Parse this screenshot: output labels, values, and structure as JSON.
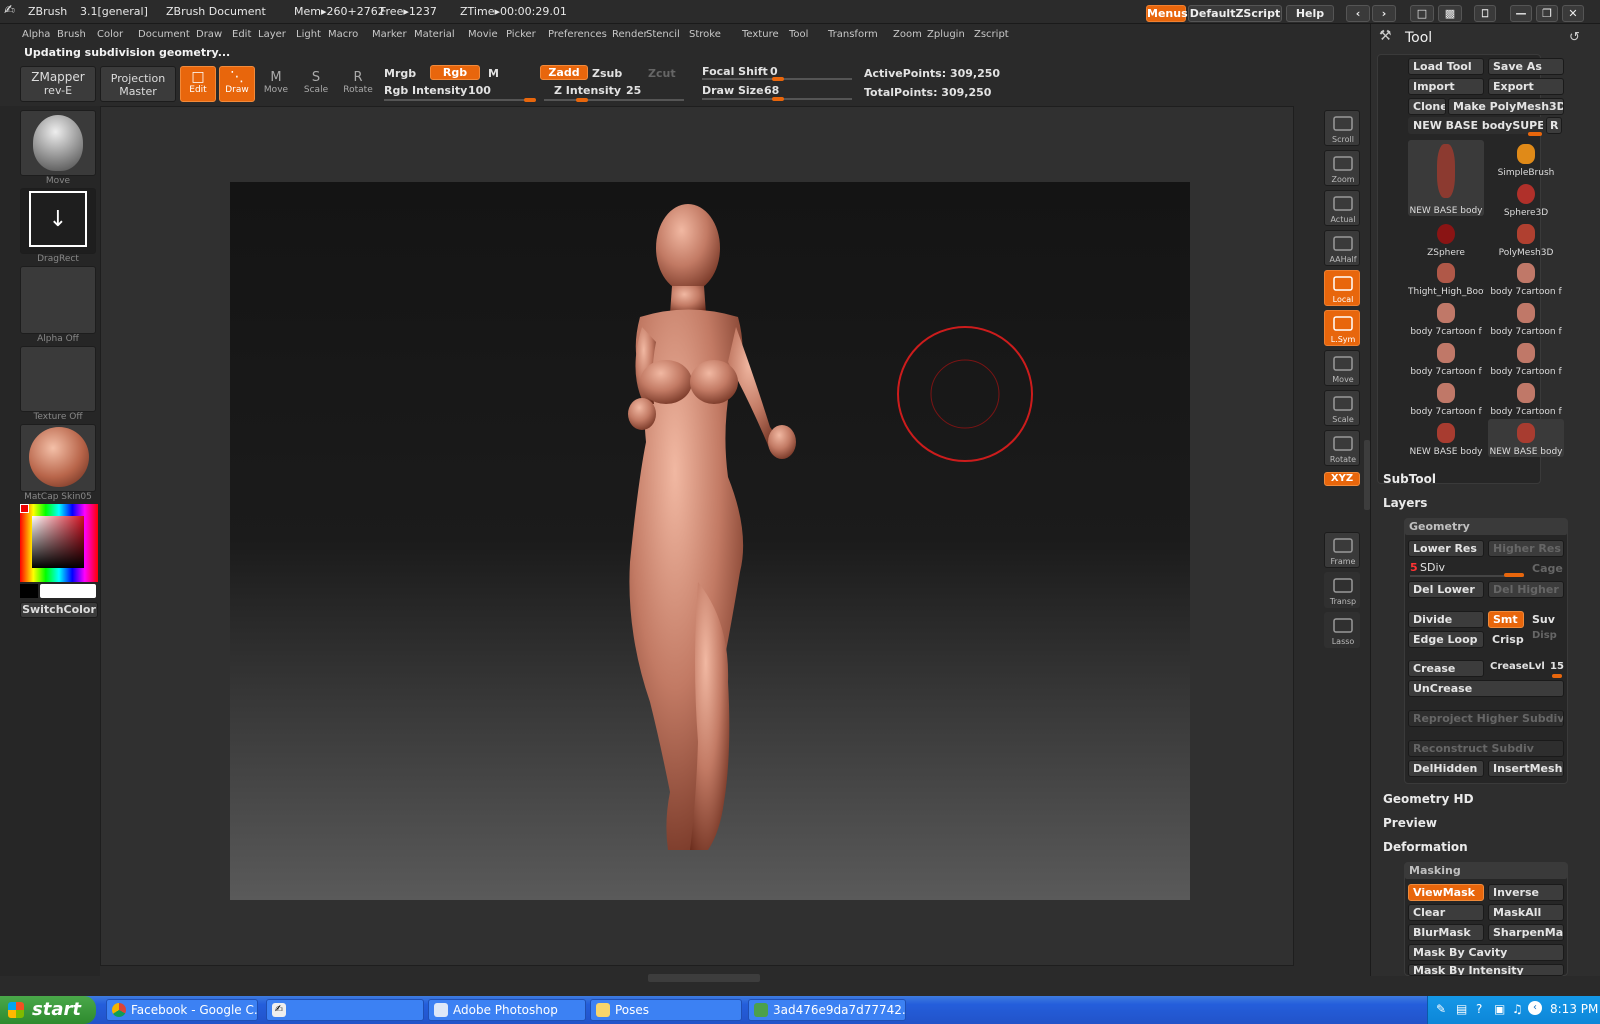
{
  "titlebar": {
    "app": "ZBrush",
    "version": "3.1[general]",
    "document": "ZBrush Document",
    "mem": "Mem▸260+2762",
    "free": "Free▸1237",
    "ztime": "ZTime▸00:00:29.01",
    "menus_btn": "Menus",
    "script_btn": "DefaultZScript",
    "help_btn": "Help"
  },
  "menubar": [
    "Alpha",
    "Brush",
    "Color",
    "Document",
    "Draw",
    "Edit",
    "Layer",
    "Light",
    "Macro",
    "Marker",
    "Material",
    "Movie",
    "Picker",
    "Preferences",
    "Render",
    "Stencil",
    "Stroke",
    "Texture",
    "Tool",
    "Transform",
    "Zoom",
    "Zplugin",
    "Zscript"
  ],
  "status": "Updating subdivision geometry...",
  "topbar": {
    "zmapper": "ZMapper",
    "zmapper_sub": "rev-E",
    "projection": "Projection",
    "projection_sub": "Master",
    "edit": "Edit",
    "draw": "Draw",
    "move": "Move",
    "scale": "Scale",
    "rotate": "Rotate",
    "mrgb": "Mrgb",
    "rgb": "Rgb",
    "m": "M",
    "zadd": "Zadd",
    "zsub": "Zsub",
    "zcut": "Zcut",
    "rgb_intensity_label": "Rgb Intensity",
    "rgb_intensity": "100",
    "z_intensity_label": "Z Intensity",
    "z_intensity": "25",
    "focal_shift_label": "Focal Shift",
    "focal_shift": "0",
    "draw_size_label": "Draw Size",
    "draw_size": "68",
    "active_points": "ActivePoints: 309,250",
    "total_points": "TotalPoints: 309,250"
  },
  "left": {
    "brush_caption": "Move",
    "stroke_caption": "DragRect",
    "alpha_caption": "Alpha  Off",
    "texture_caption": "Texture  Off",
    "material_caption": "MatCap  Skin05",
    "switchcolor": "SwitchColor"
  },
  "right_tools": [
    "Scroll",
    "Zoom",
    "Actual",
    "AAHalf",
    "Local",
    "L.Sym",
    "Move",
    "Scale",
    "Rotate",
    "XYZ",
    "Frame",
    "Transp",
    "Lasso"
  ],
  "tool_panel": {
    "title": "Tool",
    "load_tool": "Load Tool",
    "save_as": "Save As",
    "import": "Import",
    "export": "Export",
    "clone": "Clone",
    "make_polymesh": "Make PolyMesh3D",
    "current_tool": "NEW  BASE  bodySUPERGI",
    "r_btn": "R",
    "tools": [
      {
        "name": "NEW  BASE  body"
      },
      {
        "name": "SimpleBrush"
      },
      {
        "name": "Sphere3D"
      },
      {
        "name": "ZSphere"
      },
      {
        "name": "PolyMesh3D"
      },
      {
        "name": "Thight_High_Boot"
      },
      {
        "name": "body  7cartoon  f"
      },
      {
        "name": "body  7cartoon  f"
      },
      {
        "name": "body  7cartoon  f"
      },
      {
        "name": "body  7cartoon  f"
      },
      {
        "name": "body  7cartoon  f"
      },
      {
        "name": "body  7cartoon  f"
      },
      {
        "name": "body  7cartoon  f"
      },
      {
        "name": "NEW  BASE  body"
      },
      {
        "name": "NEW  BASE  body"
      }
    ],
    "subtool": "SubTool",
    "layers": "Layers",
    "geometry": "Geometry",
    "lower_res": "Lower Res",
    "higher_res": "Higher Res",
    "sdiv_value": "5",
    "sdiv_label": "SDiv",
    "cage": "Cage",
    "del_lower": "Del Lower",
    "del_higher": "Del Higher",
    "divide": "Divide",
    "smt": "Smt",
    "suv": "Suv",
    "edge_loop": "Edge Loop",
    "crisp": "Crisp",
    "disp": "Disp",
    "crease": "Crease",
    "crease_lvl_label": "CreaseLvl",
    "crease_lvl": "15",
    "uncrease": "UnCrease",
    "reproject": "Reproject  Higher  Subdiv",
    "reconstruct": "Reconstruct  Subdiv",
    "delhidden": "DelHidden",
    "insertmesh": "InsertMesh",
    "geometry_hd": "Geometry HD",
    "preview": "Preview",
    "deformation": "Deformation",
    "masking": "Masking",
    "viewmask": "ViewMask",
    "inverse": "Inverse",
    "clear": "Clear",
    "maskall": "MaskAll",
    "blurmask": "BlurMask",
    "sharpenmask": "SharpenMask",
    "mask_by_cavity": "Mask  By  Cavity",
    "mask_by_intensity": "Mask  By  Intensity"
  },
  "taskbar": {
    "start": "start",
    "items": [
      "Facebook - Google C...",
      "",
      "Adobe Photoshop",
      "Poses",
      "3ad476e9da7d77742..."
    ],
    "clock": "8:13 PM"
  },
  "colors": {
    "accent": "#e8660c",
    "skin": "#c27a64",
    "taskbar": "#245edb"
  }
}
